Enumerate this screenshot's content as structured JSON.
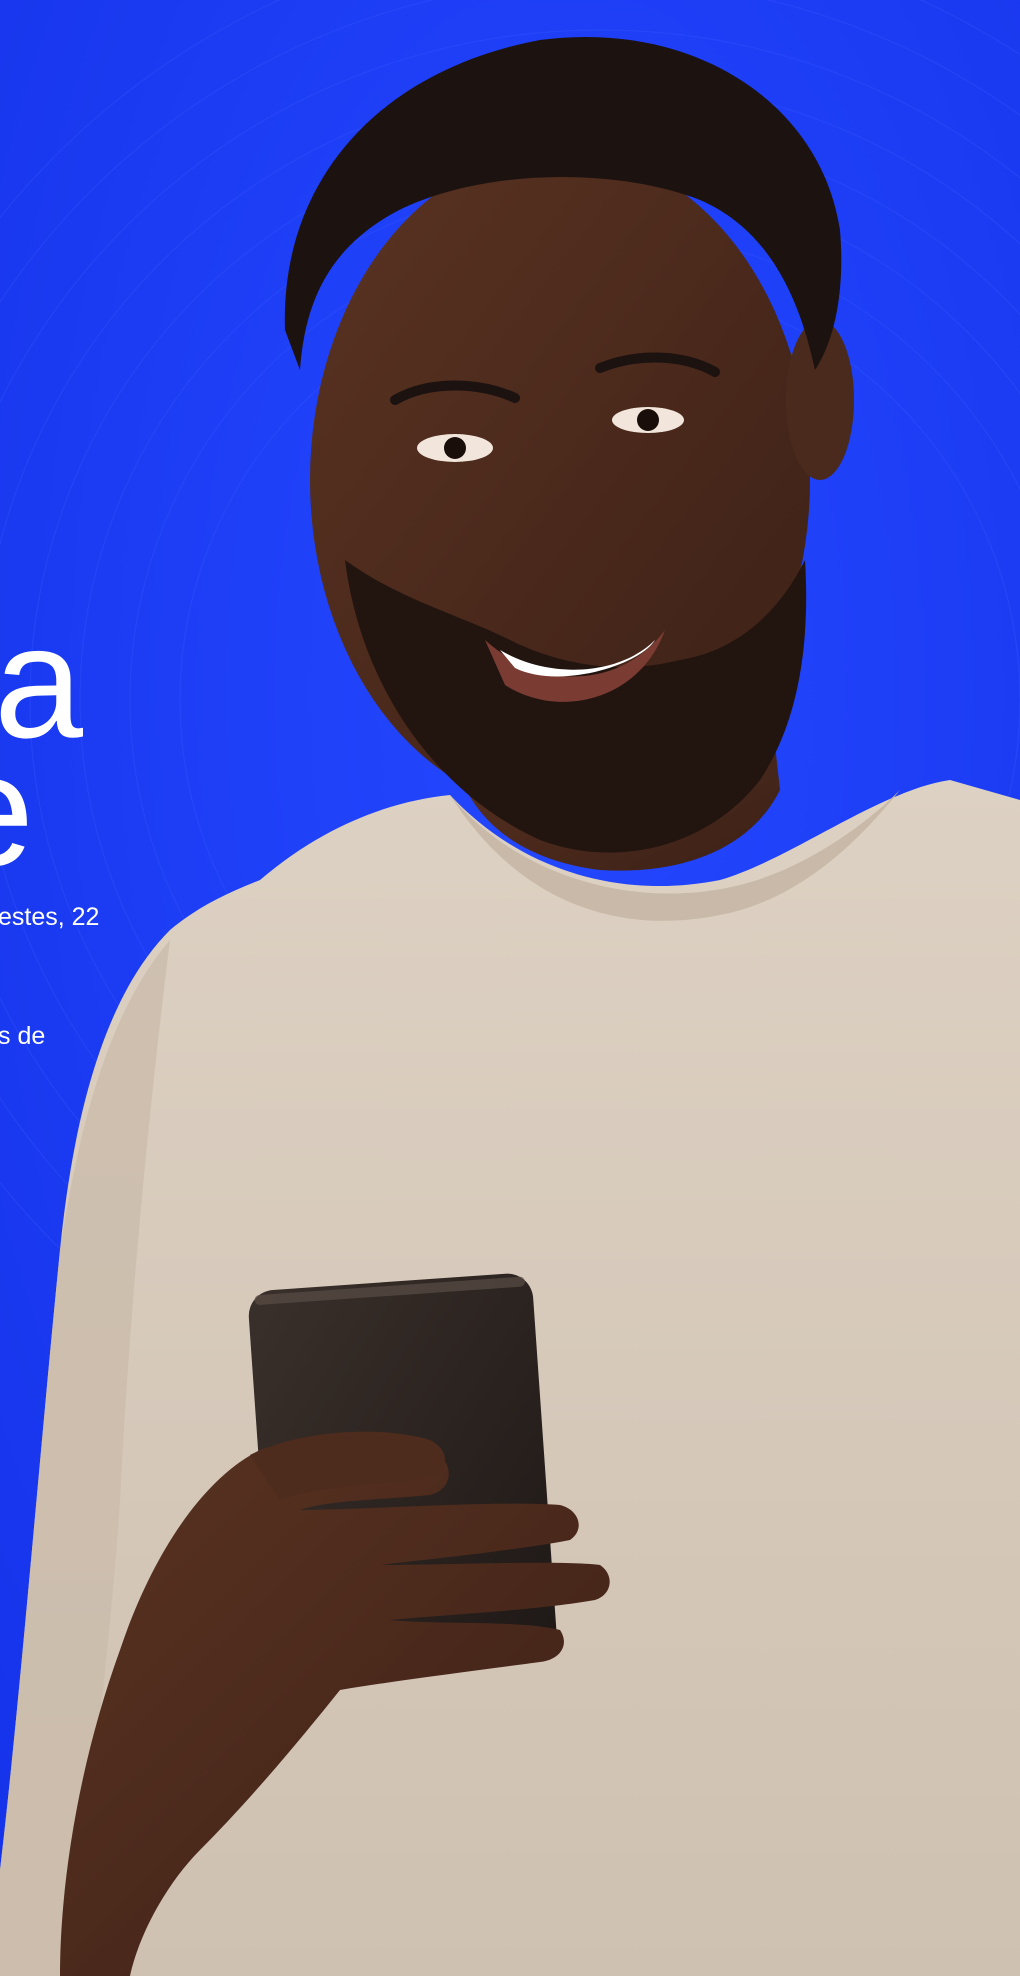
{
  "colors": {
    "background_blue": "#1a3cf5",
    "text_white": "#ffffff",
    "sweater_beige": "#d9ccbd",
    "skin_dark": "#4a2a1c",
    "phone_dark": "#2a2320"
  },
  "hero": {
    "headline_line1": "a",
    "headline_line2": "e",
    "body_line1": "estes, 22",
    "body_line2": "s de"
  },
  "photo": {
    "subject": "smiling-man-holding-smartphone"
  }
}
